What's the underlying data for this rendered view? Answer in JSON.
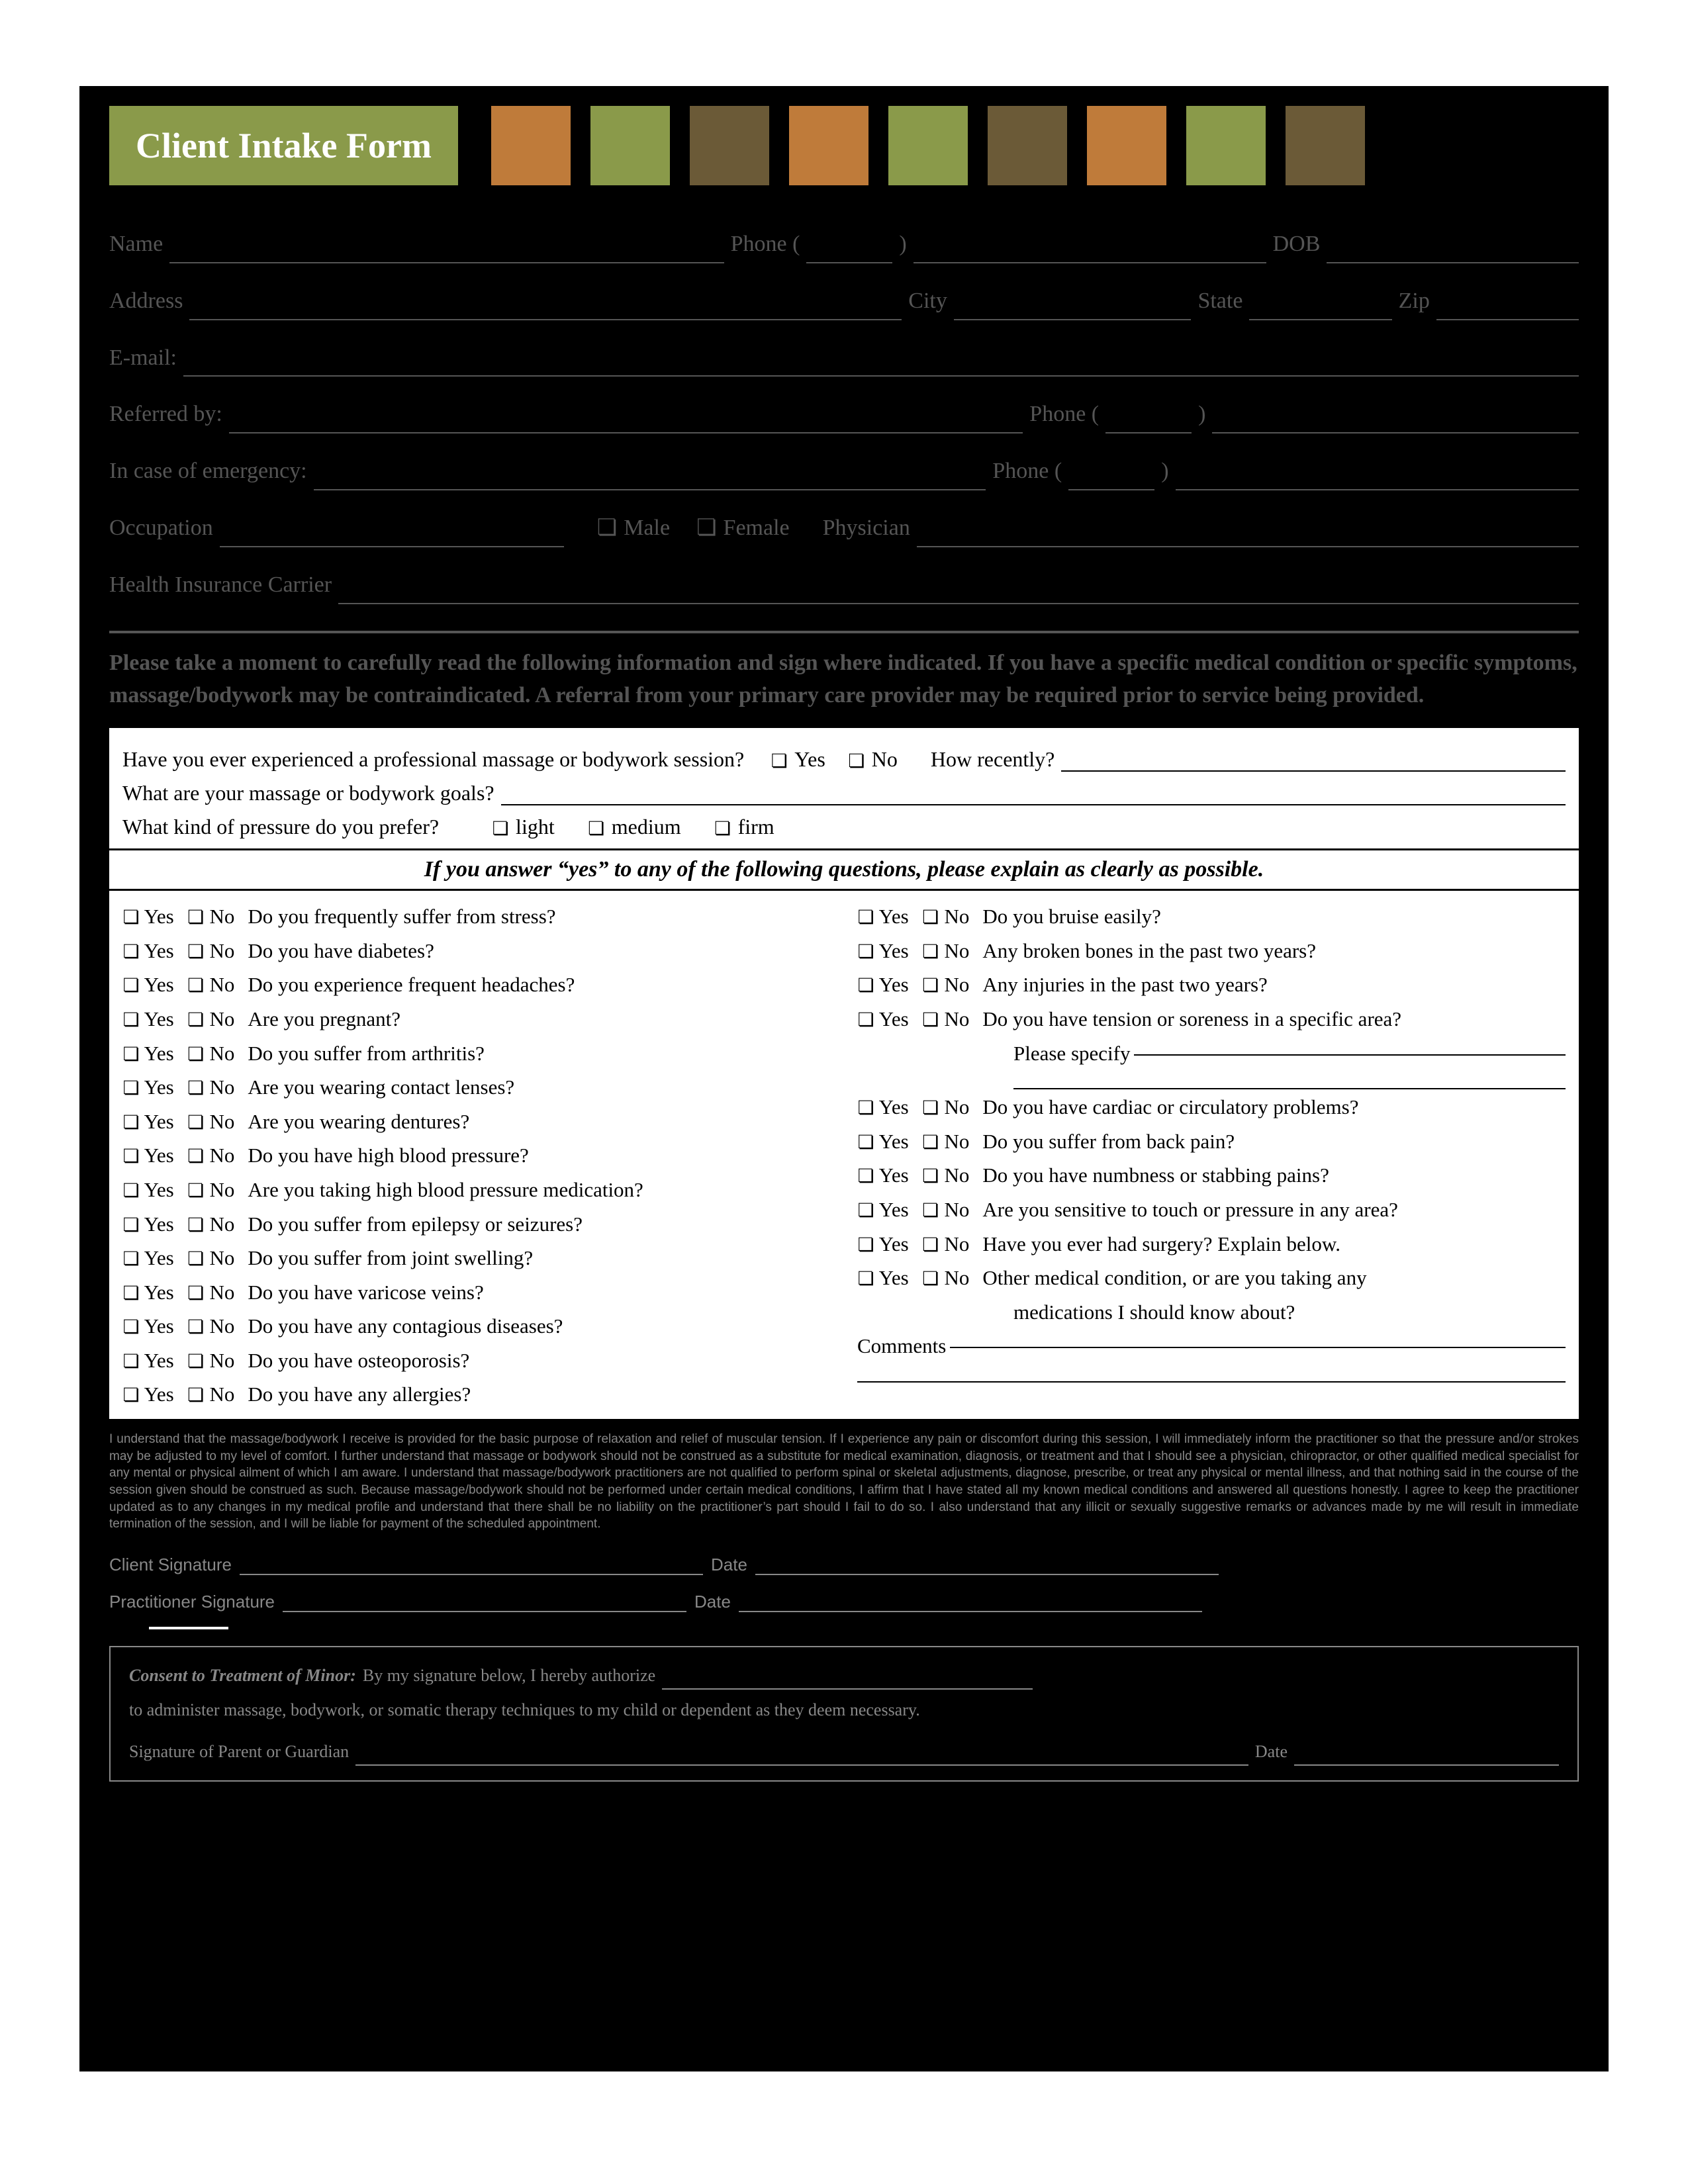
{
  "title": "Client Intake Form",
  "header_squares": [
    "#bf7b3a",
    "#8a9a4a",
    "#6b5a37",
    "#bf7b3a",
    "#8a9a4a",
    "#6b5a37",
    "#bf7b3a",
    "#8a9a4a",
    "#6b5a37"
  ],
  "fields": {
    "name": "Name",
    "phone": "Phone (",
    "phone_close": ")",
    "dob": "DOB",
    "address": "Address",
    "city": "City",
    "state": "State",
    "zip": "Zip",
    "email": "E-mail:",
    "referred": "Referred by:",
    "ref_phone": "Phone (",
    "emerg": "In case of emergency:",
    "emerg_phone": "Phone (",
    "occupation": "Occupation",
    "male": "Male",
    "female": "Female",
    "physician": "Physician",
    "insurance": "Health Insurance Carrier"
  },
  "instructions": "Please take a moment to carefully read the following information and sign where indicated. If you have a specific medical condition or specific symptoms, massage/bodywork may be contraindicated. A referral from your primary care provider may be required prior to service being provided.",
  "intro": {
    "q1a": "Have you ever experienced a professional massage or bodywork session?",
    "yes": "Yes",
    "no": "No",
    "q1b": "How recently?",
    "q2": "What are your massage or bodywork goals?",
    "q3": "What kind of pressure do you prefer?",
    "light": "light",
    "medium": "medium",
    "firm": "firm"
  },
  "band": "If you answer “yes” to any of the following questions, please explain as clearly as possible.",
  "left_questions": [
    "Do you frequently suffer from stress?",
    "Do you have diabetes?",
    "Do you experience frequent headaches?",
    "Are you pregnant?",
    "Do you suffer from arthritis?",
    "Are you wearing contact lenses?",
    "Are you wearing dentures?",
    "Do you have high blood pressure?",
    "Are you taking high blood pressure medication?",
    "Do you suffer from epilepsy or seizures?",
    "Do you suffer from joint swelling?",
    "Do you have varicose veins?",
    "Do you have any contagious diseases?",
    "Do you have osteoporosis?",
    "Do you have any allergies?"
  ],
  "right_questions_top": [
    "Do you bruise easily?",
    "Any broken bones in the past two years?",
    "Any injuries in the past two years?",
    "Do you have tension or soreness in a specific area?"
  ],
  "please_specify": "Please specify",
  "right_questions_bottom": [
    "Do you have cardiac or circulatory problems?",
    "Do you suffer from back pain?",
    "Do you have numbness or stabbing pains?",
    "Are you sensitive to touch or pressure in any area?",
    "Have you ever had surgery? Explain below.",
    "Other medical condition, or are you taking any"
  ],
  "other_line2": "medications I should know about?",
  "comments": "Comments",
  "disclaimer": "I understand that the massage/bodywork I receive is provided for the basic purpose of relaxation and relief of muscular tension. If I experience any pain or discomfort during this session, I will immediately inform the practitioner so that the pressure and/or strokes may be adjusted to my level of comfort. I further understand that massage or bodywork should not be construed as a substitute for medical examination, diagnosis, or treatment and that I should see a physician, chiropractor, or other qualified medical specialist for any mental or physical ailment of which I am aware. I understand that massage/bodywork practitioners are not qualified to perform spinal or skeletal adjustments, diagnose, prescribe, or treat any physical or mental illness, and that nothing said in the course of the session given should be construed as such. Because massage/bodywork should not be performed under certain medical conditions, I affirm that I have stated all my known medical conditions and answered all questions honestly. I agree to keep the practitioner updated as to any changes in my medical profile and understand that there shall be no liability on the practitioner’s part should I fail to do so. I also understand that any illicit or sexually suggestive remarks or advances made by me will result in immediate termination of the session, and I will be liable for payment of the scheduled appointment.",
  "sig": {
    "client": "Client Signature",
    "practitioner": "Practitioner Signature",
    "date": "Date"
  },
  "minor": {
    "title": "Consent to Treatment of Minor:",
    "text1": "By my signature below, I hereby authorize",
    "text2": "to administer massage, bodywork, or somatic therapy techniques to my child or dependent as they deem necessary.",
    "sig": "Signature of Parent or Guardian",
    "date": "Date"
  }
}
